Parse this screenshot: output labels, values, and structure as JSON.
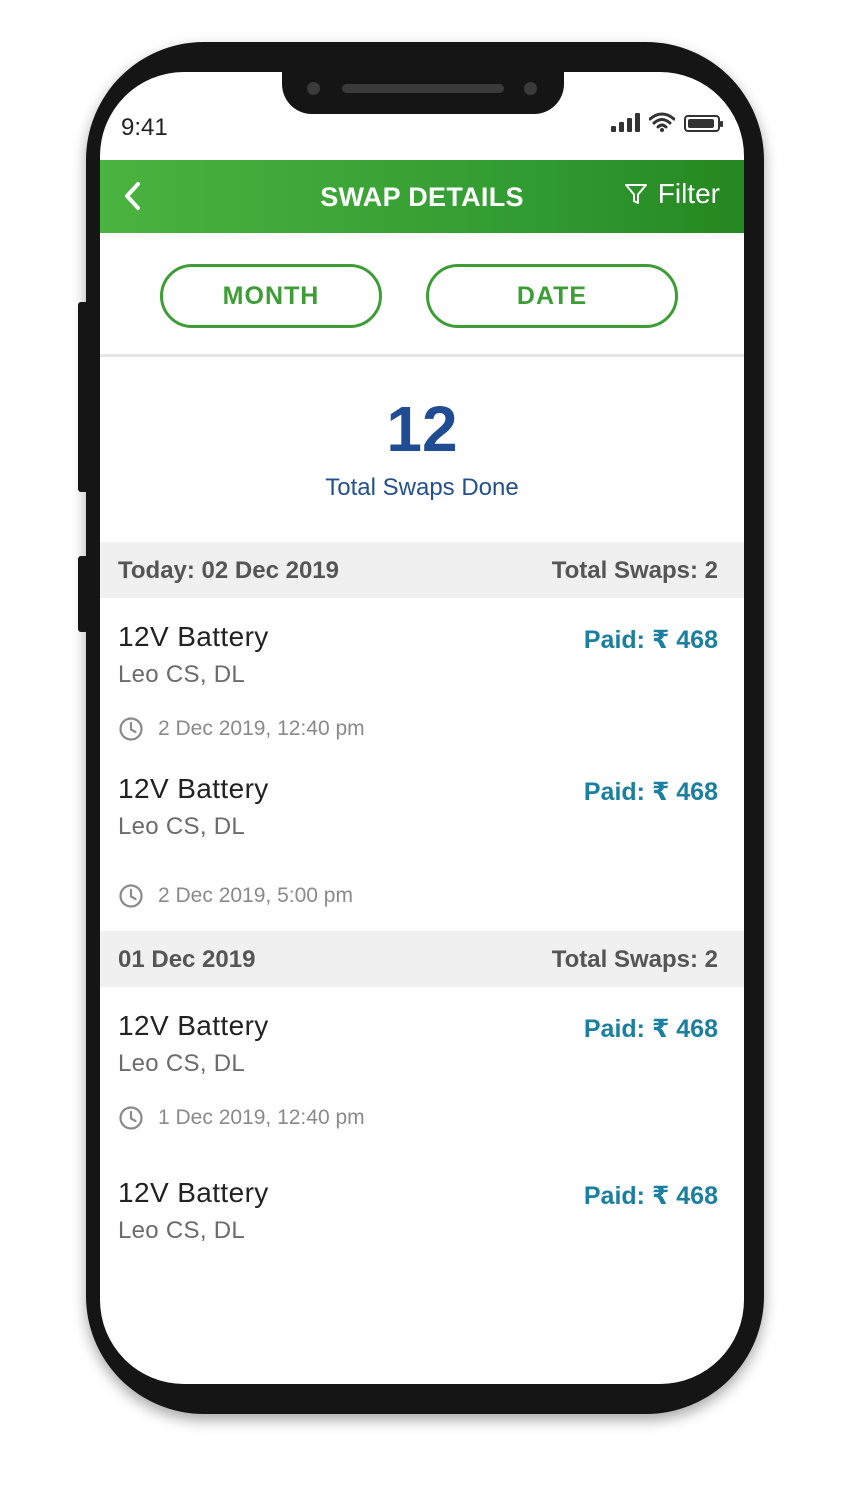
{
  "status_bar": {
    "time": "9:41"
  },
  "header": {
    "title": "SWAP DETAILS",
    "filter_label": "Filter"
  },
  "tabs": {
    "month": "MONTH",
    "date": "DATE"
  },
  "summary": {
    "count": "12",
    "label": "Total Swaps Done"
  },
  "sections": [
    {
      "date": "Today: 02 Dec 2019",
      "total": "Total Swaps: 2",
      "items": [
        {
          "name": "12V Battery",
          "location": "Leo CS, DL",
          "paid": "Paid: ₹ 468",
          "time": "2 Dec 2019, 12:40 pm"
        },
        {
          "name": "12V Battery",
          "location": "Leo CS, DL",
          "paid": "Paid: ₹ 468",
          "time": "2 Dec 2019, 5:00 pm"
        }
      ]
    },
    {
      "date": "01 Dec 2019",
      "total": "Total Swaps: 2",
      "items": [
        {
          "name": "12V Battery",
          "location": "Leo CS, DL",
          "paid": "Paid: ₹ 468",
          "time": "1 Dec 2019, 12:40 pm"
        },
        {
          "name": "12V Battery",
          "location": "Leo CS, DL",
          "paid": "Paid: ₹ 468"
        }
      ]
    }
  ]
}
